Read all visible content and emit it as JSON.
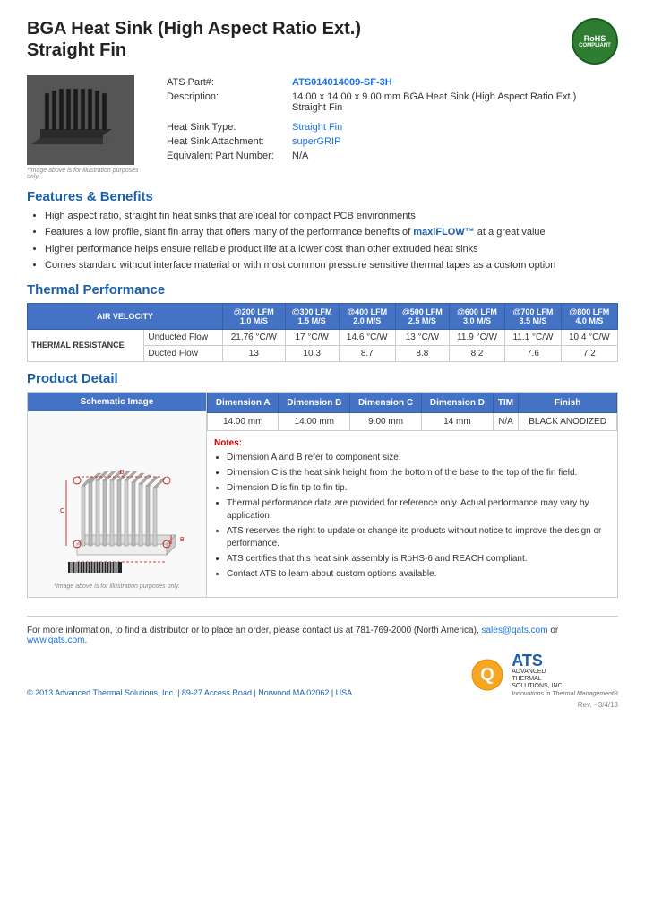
{
  "page": {
    "title_line1": "BGA Heat Sink (High Aspect Ratio Ext.)",
    "title_line2": "Straight Fin"
  },
  "rohs": {
    "label": "RoHS",
    "sublabel": "COMPLIANT"
  },
  "product": {
    "part_label": "ATS Part#:",
    "part_number": "ATS014014009-SF-3H",
    "description_label": "Description:",
    "description": "14.00 x 14.00 x 9.00 mm  BGA Heat Sink (High Aspect Ratio Ext.) Straight Fin",
    "heat_sink_type_label": "Heat Sink Type:",
    "heat_sink_type": "Straight Fin",
    "heat_sink_attachment_label": "Heat Sink Attachment:",
    "heat_sink_attachment": "superGRIP",
    "equivalent_part_label": "Equivalent Part Number:",
    "equivalent_part": "N/A",
    "image_caption": "*Image above is for illustration purposes only."
  },
  "features": {
    "title": "Features & Benefits",
    "items": [
      "High aspect ratio, straight fin heat sinks that are ideal for compact PCB environments",
      "Features a low profile, slant fin array that offers many of the performance benefits of maxiFLOW™ at a great value",
      "Higher performance helps ensure reliable product life at a lower cost than other extruded heat sinks",
      "Comes standard without interface material or with most common pressure sensitive thermal tapes as a custom option"
    ]
  },
  "thermal_performance": {
    "title": "Thermal Performance",
    "table": {
      "header_air_velocity": "AIR VELOCITY",
      "columns": [
        "@200 LFM\n1.0 M/S",
        "@300 LFM\n1.5 M/S",
        "@400 LFM\n2.0 M/S",
        "@500 LFM\n2.5 M/S",
        "@600 LFM\n3.0 M/S",
        "@700 LFM\n3.5 M/S",
        "@800 LFM\n4.0 M/S"
      ],
      "thermal_resistance_label": "THERMAL RESISTANCE",
      "rows": [
        {
          "label": "Unducted Flow",
          "values": [
            "21.76 °C/W",
            "17 °C/W",
            "14.6 °C/W",
            "13 °C/W",
            "11.9 °C/W",
            "11.1 °C/W",
            "10.4 °C/W"
          ]
        },
        {
          "label": "Ducted Flow",
          "values": [
            "13",
            "10.3",
            "8.7",
            "8.8",
            "8.2",
            "7.6",
            "7.2"
          ]
        }
      ]
    }
  },
  "product_detail": {
    "title": "Product Detail",
    "schematic_header": "Schematic Image",
    "schematic_caption": "*Image above is for illustration purposes only.",
    "table_headers": [
      "Dimension A",
      "Dimension B",
      "Dimension C",
      "Dimension D",
      "TIM",
      "Finish"
    ],
    "table_values": [
      "14.00 mm",
      "14.00 mm",
      "9.00 mm",
      "14 mm",
      "N/A",
      "BLACK ANODIZED"
    ],
    "notes_label": "Notes:",
    "notes": [
      "Dimension A and B refer to component size.",
      "Dimension C is the heat sink height from the bottom of the base to the top of the fin field.",
      "Dimension D is fin tip to fin tip.",
      "Thermal performance data are provided for reference only. Actual performance may vary by application.",
      "ATS reserves the right to update or change its products without notice to improve the design or performance.",
      "ATS certifies that this heat sink assembly is RoHS-6 and REACH compliant.",
      "Contact ATS to learn about custom options available."
    ]
  },
  "footer": {
    "contact_text": "For more information, to find a distributor or to place an order, please contact us at 781-769-2000 (North America),",
    "email": "sales@qats.com",
    "or_text": "or",
    "website": "www.qats.com",
    "copyright": "© 2013 Advanced Thermal Solutions, Inc.  |  89-27 Access Road  |  Norwood MA  02062  |  USA",
    "ats_label": "ATS",
    "ats_fullname_line1": "ADVANCED",
    "ats_fullname_line2": "THERMAL",
    "ats_fullname_line3": "SOLUTIONS, INC.",
    "tagline": "Innovations in Thermal Management®",
    "rev": "Rev. - 3/4/13"
  }
}
